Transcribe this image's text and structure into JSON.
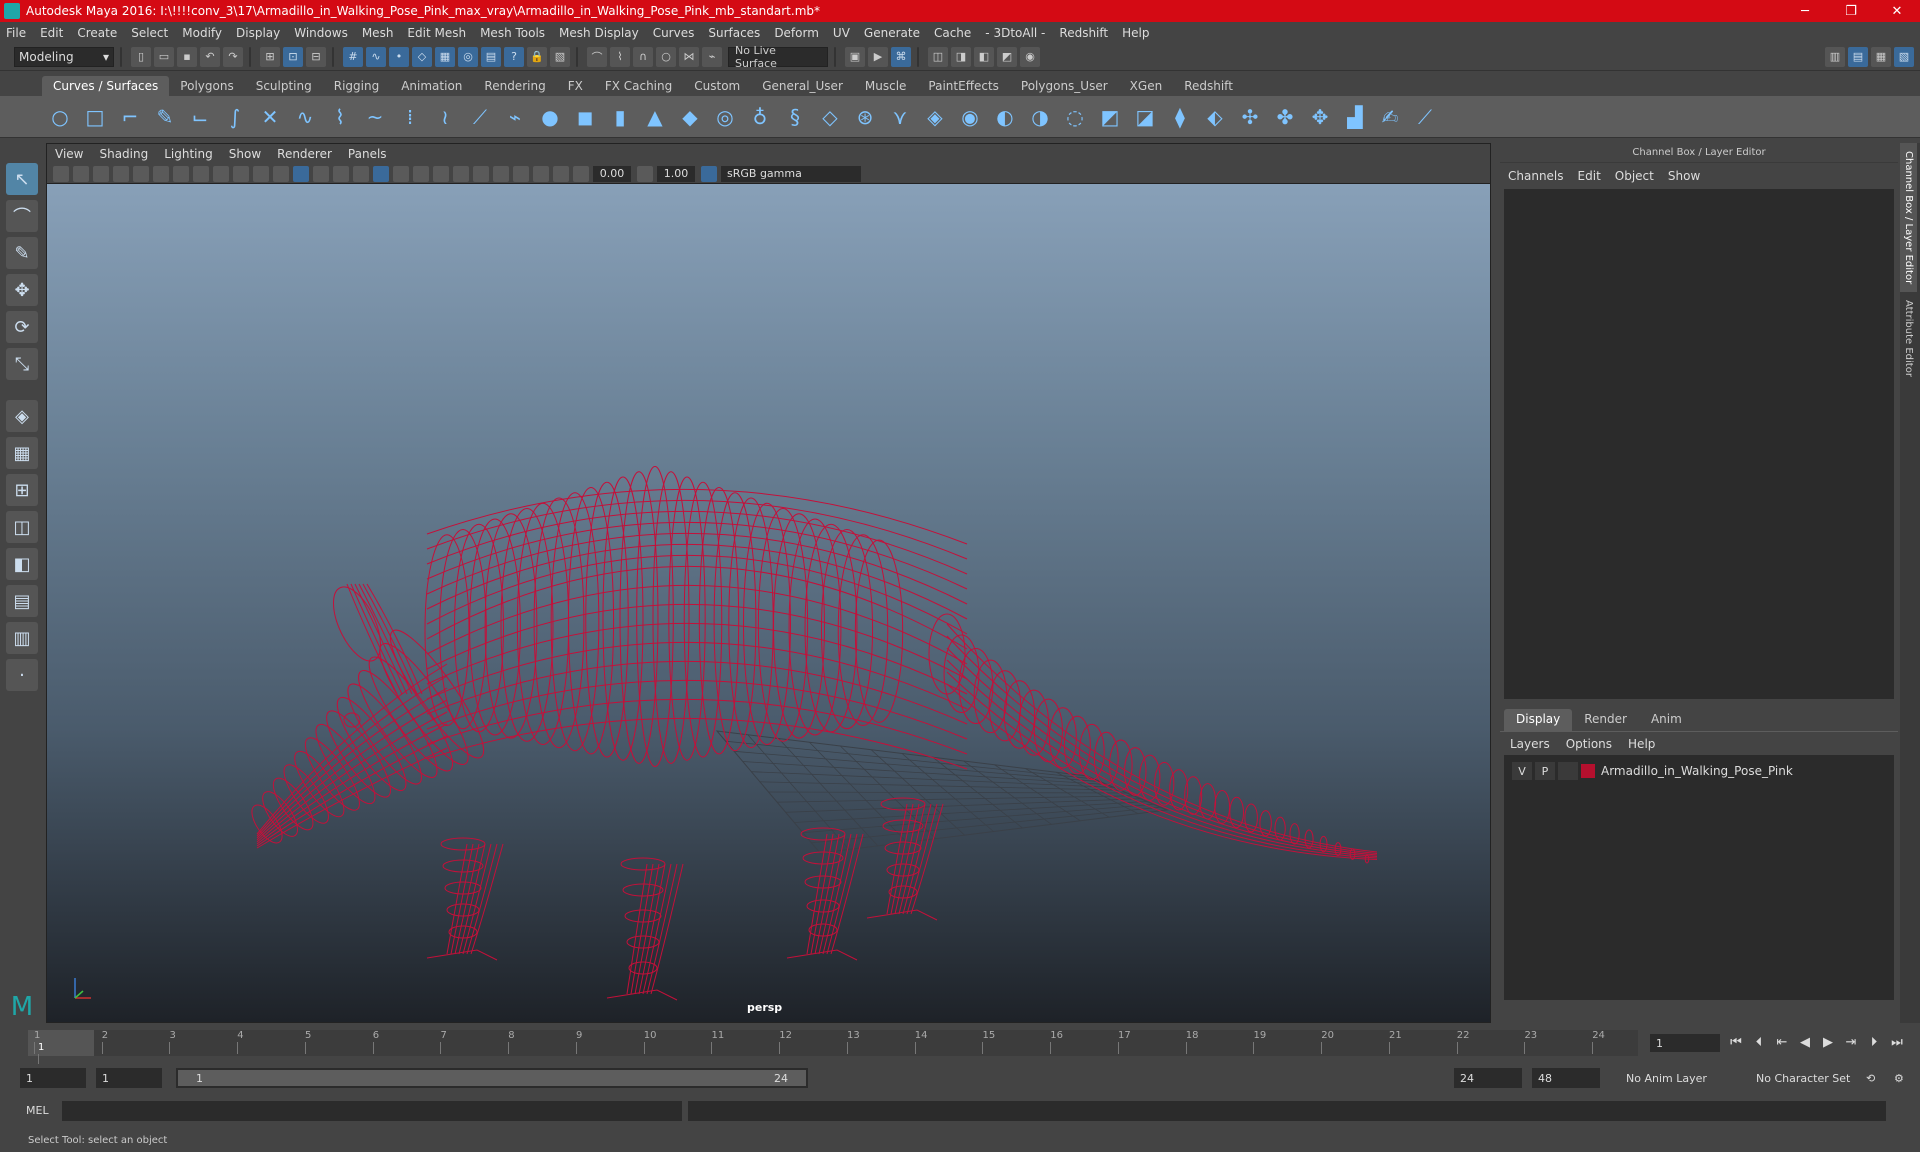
{
  "app": {
    "title": "Autodesk Maya 2016: I:\\!!!!conv_3\\17\\Armadillo_in_Walking_Pose_Pink_max_vray\\Armadillo_in_Walking_Pose_Pink_mb_standart.mb*",
    "minimize": "─",
    "maximize": "❐",
    "close": "✕"
  },
  "menu": [
    "File",
    "Edit",
    "Create",
    "Select",
    "Modify",
    "Display",
    "Windows",
    "Mesh",
    "Edit Mesh",
    "Mesh Tools",
    "Mesh Display",
    "Curves",
    "Surfaces",
    "Deform",
    "UV",
    "Generate",
    "Cache",
    "- 3DtoAll -",
    "Redshift",
    "Help"
  ],
  "status": {
    "mode": "Modeling",
    "live_surface": "No Live Surface"
  },
  "shelf_tabs": [
    "Curves / Surfaces",
    "Polygons",
    "Sculpting",
    "Rigging",
    "Animation",
    "Rendering",
    "FX",
    "FX Caching",
    "Custom",
    "General_User",
    "Muscle",
    "PaintEffects",
    "Polygons_User",
    "XGen",
    "Redshift"
  ],
  "shelf_active": "Curves / Surfaces",
  "viewport": {
    "menu": [
      "View",
      "Shading",
      "Lighting",
      "Show",
      "Renderer",
      "Panels"
    ],
    "exposure": "0.00",
    "gamma": "1.00",
    "color_space": "sRGB gamma",
    "camera": "persp",
    "wire_color": "#c4103a"
  },
  "right_panel": {
    "header": "Channel Box / Layer Editor",
    "menu": [
      "Channels",
      "Edit",
      "Object",
      "Show"
    ],
    "layer_tabs": [
      "Display",
      "Render",
      "Anim"
    ],
    "layer_menu": [
      "Layers",
      "Options",
      "Help"
    ],
    "layer": {
      "visible": "V",
      "playback": "P",
      "name": "Armadillo_in_Walking_Pose_Pink",
      "color": "#b5102e"
    },
    "side_tabs": [
      "Channel Box / Layer Editor",
      "Attribute Editor"
    ]
  },
  "timeline": {
    "ticks": [
      "1",
      "2",
      "3",
      "4",
      "5",
      "6",
      "7",
      "8",
      "9",
      "10",
      "11",
      "12",
      "13",
      "14",
      "15",
      "16",
      "17",
      "18",
      "19",
      "20",
      "21",
      "22",
      "23",
      "24"
    ],
    "current_frame": "1",
    "frame_field": "1"
  },
  "range": {
    "start": "1",
    "playback_start": "1",
    "slider_start": "1",
    "slider_end": "24",
    "playback_end": "24",
    "end": "48",
    "anim_layer": "No Anim Layer",
    "character_set": "No Character Set"
  },
  "cmd": {
    "label": "MEL",
    "help": "Select Tool: select an object"
  }
}
